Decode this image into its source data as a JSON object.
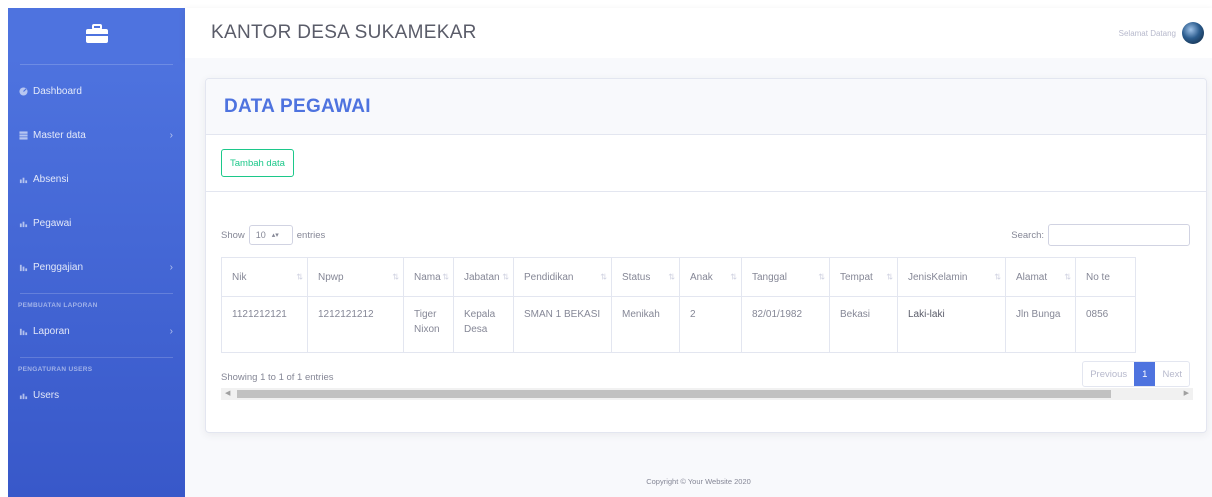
{
  "sidebar": {
    "items": [
      {
        "label": "Dashboard",
        "icon": "dashboard-icon"
      },
      {
        "label": "Master data",
        "icon": "table-icon"
      },
      {
        "label": "Absensi",
        "icon": "chart-icon"
      },
      {
        "label": "Pegawai",
        "icon": "chart-icon"
      },
      {
        "label": "Penggajian",
        "icon": "chart-icon"
      }
    ],
    "heading_reports": "PEMBUATAN LAPORAN",
    "item_laporan": "Laporan",
    "heading_users": "PENGATURAN USERS",
    "item_users": "Users"
  },
  "topbar": {
    "title": "KANTOR DESA SUKAMEKAR",
    "welcome": "Selamat Datang"
  },
  "page": {
    "heading": "DATA PEGAWAI",
    "add_button": "Tambah data"
  },
  "table_controls": {
    "show_label": "Show",
    "entries_value": "10",
    "entries_label": "entries",
    "search_label": "Search:"
  },
  "table": {
    "columns": [
      "Nik",
      "Npwp",
      "Nama",
      "Jabatan",
      "Pendidikan",
      "Status",
      "Anak",
      "Tanggal",
      "Tempat",
      "JenisKelamin",
      "Alamat",
      "No te"
    ],
    "rows": [
      [
        "1121212121",
        "1212121212",
        "Tiger Nixon",
        "Kepala Desa",
        "SMAN 1 BEKASI",
        "Menikah",
        "2",
        "82/01/1982",
        "Bekasi",
        "Laki-laki",
        "Jln Bunga",
        "0856"
      ]
    ]
  },
  "pagination": {
    "info": "Showing 1 to 1 of 1 entries",
    "previous": "Previous",
    "current": "1",
    "next": "Next"
  },
  "footer": {
    "copyright": "Copyright © Your Website 2020"
  },
  "colors": {
    "primary": "#4e73df",
    "success": "#1cc88a",
    "text": "#858796"
  }
}
